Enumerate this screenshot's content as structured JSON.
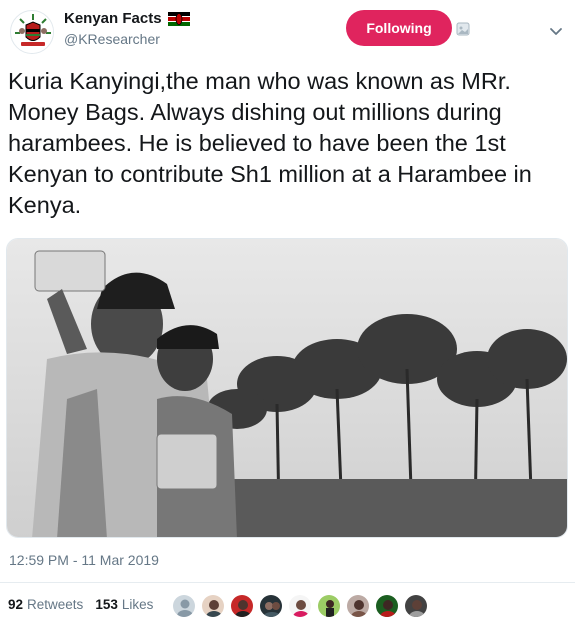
{
  "account": {
    "display_name": "Kenyan Facts",
    "handle": "@KResearcher",
    "follow_label": "Following"
  },
  "tweet": {
    "text": "Kuria Kanyingi,the man who was known as MRr. Money Bags. Always dishing out millions during harambees. He is believed to have been the 1st Kenyan to contribute Sh1 million at a Harambee in Kenya.",
    "timestamp": "12:59 PM - 11 Mar 2019"
  },
  "stats": {
    "retweets_count": "92",
    "retweets_label": "Retweets",
    "likes_count": "153",
    "likes_label": "Likes"
  },
  "colors": {
    "follow_bg": "#e0245e",
    "muted_text": "#657786",
    "primary_text": "#14171a"
  },
  "icons": [
    "kenya-coat-of-arms-avatar",
    "kenya-flag-icon",
    "block-icon",
    "chevron-down-icon"
  ]
}
